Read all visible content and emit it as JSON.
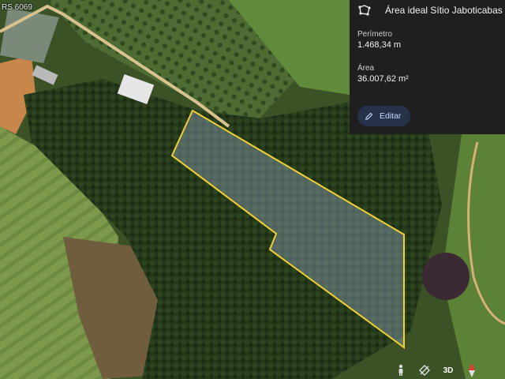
{
  "map": {
    "road_label": "RS 6069",
    "boundary_color": "#f2d22e"
  },
  "panel": {
    "title": "Área ideal Sítio Jaboticabas",
    "perimeter_label": "Perímetro",
    "perimeter_value": "1.468,34 m",
    "area_label": "Área",
    "area_value": "36.007,62 m²",
    "edit_label": "Editar"
  },
  "controls": {
    "pegman_icon": "pegman-icon",
    "rotate_icon": "rotate-icon",
    "view_3d_label": "3D",
    "compass_icon": "compass-icon"
  }
}
